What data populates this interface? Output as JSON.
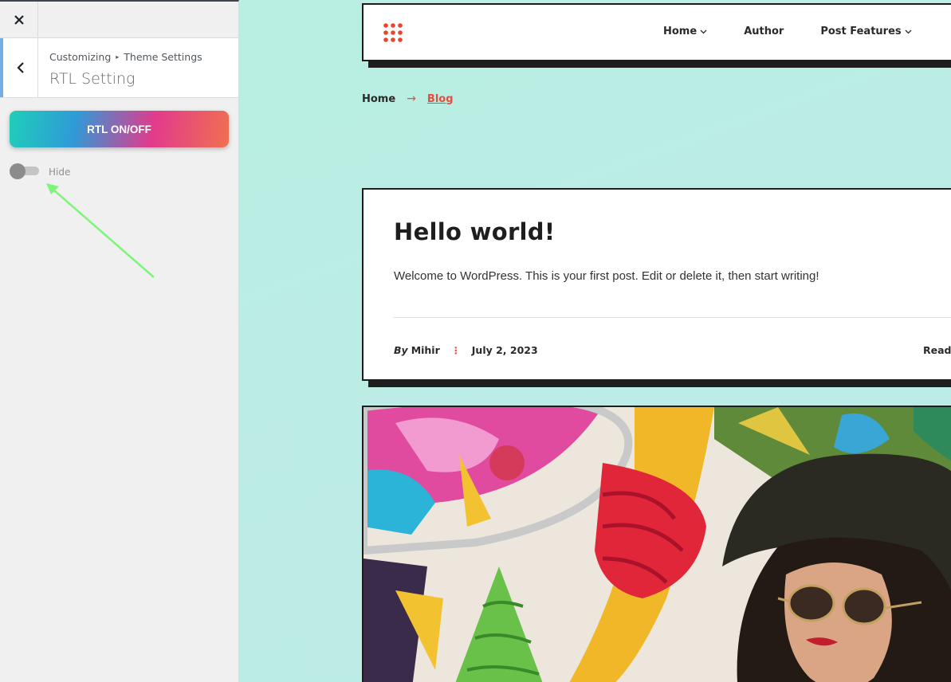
{
  "sidebar": {
    "close_icon": "close-icon",
    "back_icon": "chevron-left-icon",
    "breadcrumb": [
      "Customizing",
      "Theme Settings"
    ],
    "breadcrumb_separator": "▸",
    "section_title": "RTL Setting",
    "rtl_button_label": "RTL ON/OFF",
    "toggle": {
      "label": "Hide",
      "checked": false
    },
    "accent_color": "#72aee6"
  },
  "preview": {
    "logo_icon": "dots-grid-icon",
    "nav": [
      {
        "label": "Home",
        "has_dropdown": true
      },
      {
        "label": "Author",
        "has_dropdown": false
      },
      {
        "label": "Post Features",
        "has_dropdown": true
      }
    ],
    "breadcrumb": {
      "home": "Home",
      "arrow": "→",
      "current": "Blog"
    },
    "post": {
      "title": "Hello world!",
      "excerpt": "Welcome to WordPress. This is your first post. Edit or delete it, then start writing!",
      "by": "By",
      "author": "Mihir",
      "meta_separator": "⋮",
      "date": "July 2, 2023",
      "read_more": "Read"
    },
    "accent_color": "#e74c3c"
  }
}
